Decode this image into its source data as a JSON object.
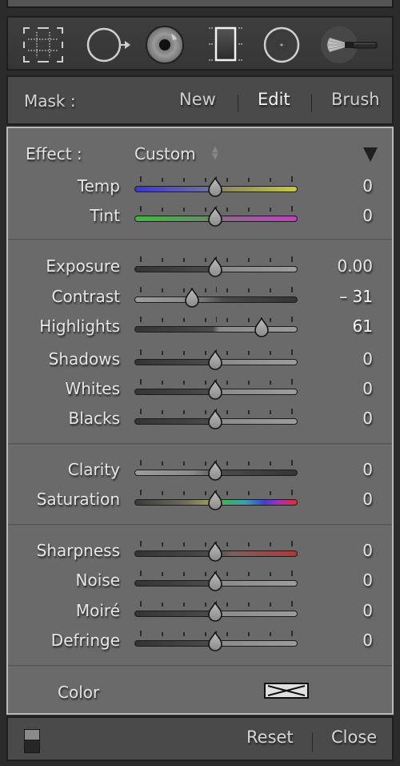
{
  "toolbar": {
    "tools": [
      {
        "name": "crop-overlay-icon",
        "active": false
      },
      {
        "name": "spot-removal-icon",
        "active": false
      },
      {
        "name": "red-eye-icon",
        "active": false
      },
      {
        "name": "graduated-filter-icon",
        "active": false
      },
      {
        "name": "radial-filter-icon",
        "active": false
      },
      {
        "name": "adjustment-brush-icon",
        "active": true
      }
    ]
  },
  "mask": {
    "label": "Mask :",
    "new_label": "New",
    "edit_label": "Edit",
    "brush_label": "Brush",
    "active": "Edit"
  },
  "effect": {
    "label": "Effect :",
    "value": "Custom"
  },
  "sliders": [
    {
      "id": "temp",
      "label": "Temp",
      "value": "0",
      "position": 0,
      "track": "temp",
      "group": 0
    },
    {
      "id": "tint",
      "label": "Tint",
      "value": "0",
      "position": 0,
      "track": "tint",
      "group": 0
    },
    {
      "id": "exposure",
      "label": "Exposure",
      "value": "0.00",
      "position": 0,
      "track": "dark-light",
      "group": 1
    },
    {
      "id": "contrast",
      "label": "Contrast",
      "value": "– 31",
      "position": -31,
      "track": "light-dark",
      "group": 1,
      "bright": true
    },
    {
      "id": "highlights",
      "label": "Highlights",
      "value": "61",
      "position": 61,
      "track": "dark-light",
      "group": 1,
      "bright": true
    },
    {
      "id": "shadows",
      "label": "Shadows",
      "value": "0",
      "position": 0,
      "track": "dark-light",
      "group": 1
    },
    {
      "id": "whites",
      "label": "Whites",
      "value": "0",
      "position": 0,
      "track": "dark-light",
      "group": 1
    },
    {
      "id": "blacks",
      "label": "Blacks",
      "value": "0",
      "position": 0,
      "track": "dark-light",
      "group": 1
    },
    {
      "id": "clarity",
      "label": "Clarity",
      "value": "0",
      "position": 0,
      "track": "light-dark",
      "group": 2
    },
    {
      "id": "saturation",
      "label": "Saturation",
      "value": "0",
      "position": 0,
      "track": "saturation",
      "group": 2
    },
    {
      "id": "sharpness",
      "label": "Sharpness",
      "value": "0",
      "position": 0,
      "track": "sharpness",
      "group": 3
    },
    {
      "id": "noise",
      "label": "Noise",
      "value": "0",
      "position": 0,
      "track": "dark-light",
      "group": 3
    },
    {
      "id": "moire",
      "label": "Moiré",
      "value": "0",
      "position": 0,
      "track": "dark-light",
      "group": 3
    },
    {
      "id": "defringe",
      "label": "Defringe",
      "value": "0",
      "position": 0,
      "track": "dark-light",
      "group": 3
    }
  ],
  "slider_range": [
    -100,
    100
  ],
  "color": {
    "label": "Color",
    "swatch": "none"
  },
  "footer": {
    "reset_label": "Reset",
    "close_label": "Close"
  }
}
